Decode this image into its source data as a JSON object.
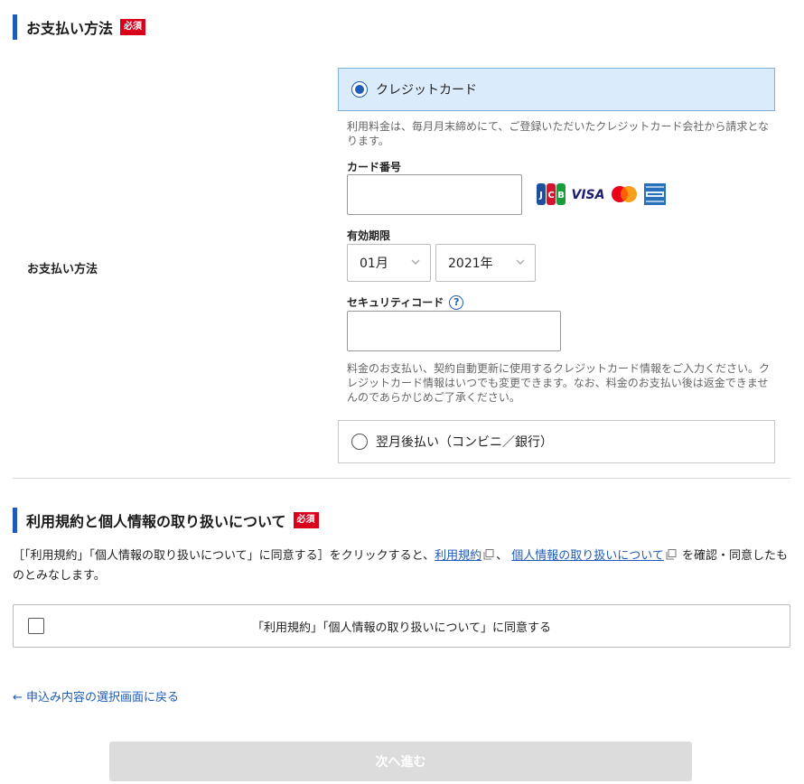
{
  "payment": {
    "section_title": "お支払い方法",
    "required_badge": "必須",
    "row_label": "お支払い方法",
    "credit_card": {
      "label": "クレジットカード",
      "selected": true,
      "note": "利用料金は、毎月月末締めにて、ご登録いただいたクレジットカード会社から請求となります。",
      "card_number_label": "カード番号",
      "card_number_value": "",
      "brands": [
        "JCB",
        "VISA",
        "Mastercard",
        "AMERICAN EXPRESS"
      ],
      "brand_icons": [
        "jcb-icon",
        "visa-icon",
        "mastercard-icon",
        "amex-icon"
      ],
      "expiry_label": "有効期限",
      "expiry_month": "01月",
      "expiry_year": "2021年",
      "security_code_label": "セキュリティコード",
      "security_help": "?",
      "security_code_value": "",
      "usage_note": "料金のお支払い、契約自動更新に使用するクレジットカード情報をご入力ください。クレジットカード情報はいつでも変更できます。なお、料金のお支払い後は返金できませんのであらかじめご了承ください。"
    },
    "deferred": {
      "label": "翌月後払い（コンビニ／銀行）",
      "selected": false
    }
  },
  "terms": {
    "section_title": "利用規約と個人情報の取り扱いについて",
    "required_badge": "必須",
    "text_before": "［「利用規約」「個人情報の取り扱いについて」に同意する］をクリックすると、",
    "link_terms": "利用規約",
    "separator": "、",
    "link_privacy": "個人情報の取り扱いについて",
    "text_after": "を確認・同意したものとみなします。",
    "agree_label": "「利用規約」「個人情報の取り扱いについて」に同意する",
    "agree_checked": false
  },
  "nav": {
    "back_link": "← 申込み内容の選択画面に戻る",
    "next_button": "次へ進む"
  },
  "colors": {
    "accent": "#1f5bb8",
    "required": "#d8001a",
    "selected_bg": "#daecfb",
    "disabled_button": "#dcdcdc"
  }
}
